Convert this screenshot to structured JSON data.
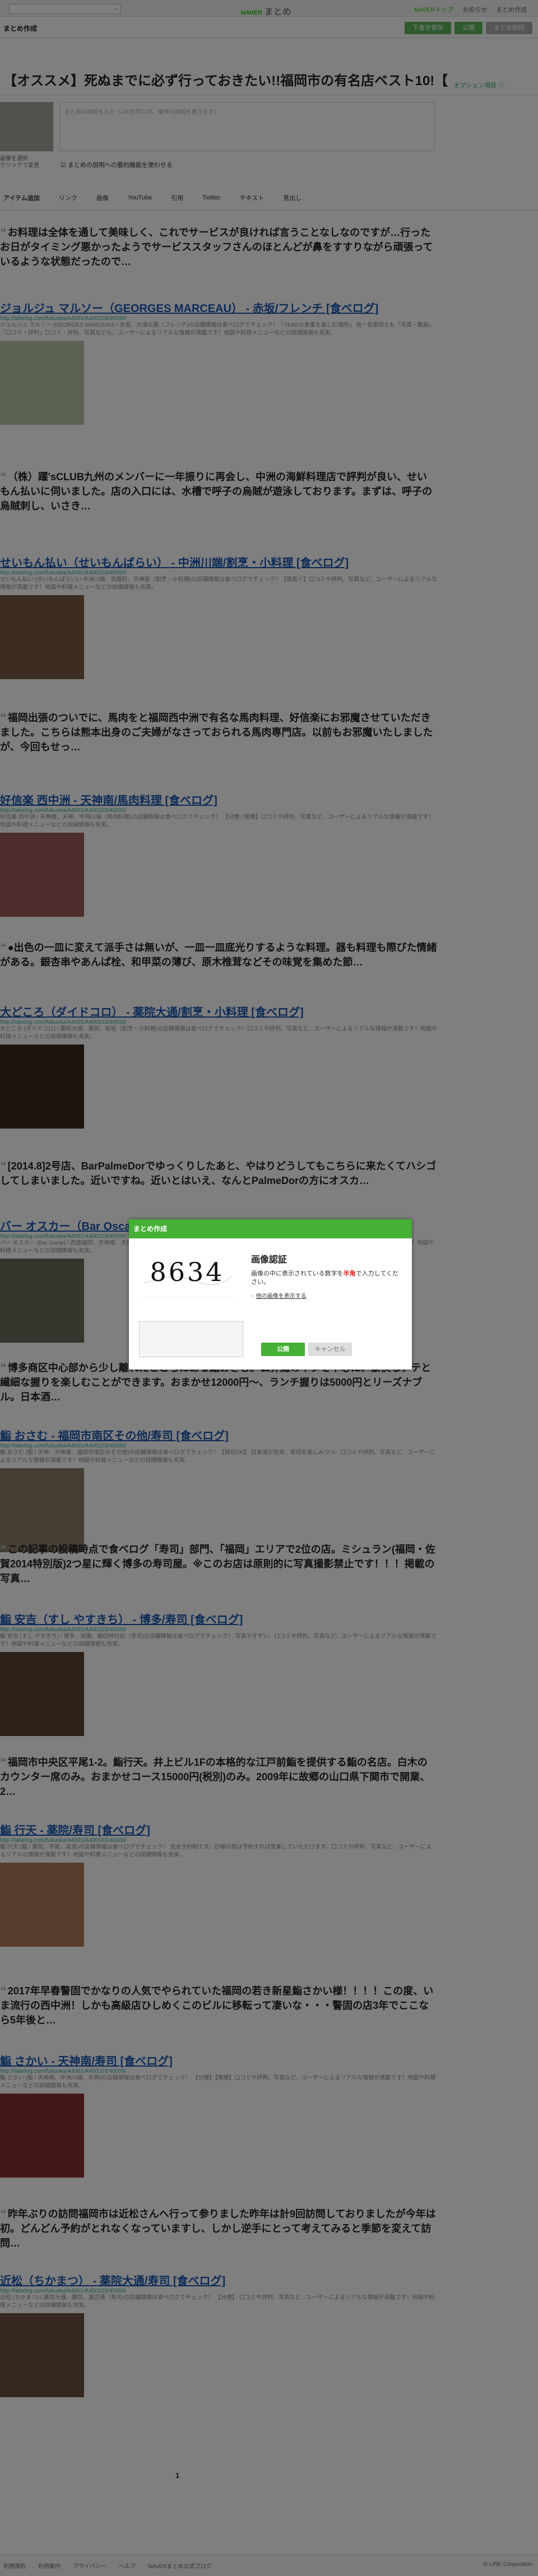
{
  "topbar": {
    "brand_naver": "NAVER",
    "brand_name": "まとめ",
    "links": [
      "NAVERトップ",
      "お知らせ",
      "まとめ作成"
    ]
  },
  "subbar": {
    "title": "まとめ作成",
    "buttons": [
      "下書き保存",
      "公開",
      "まとめ削除"
    ]
  },
  "matome": {
    "title": "【オススメ】死ぬまでに必ず行っておきたい!!福岡市の有名店ベスト10!【",
    "option": "オプション項目 ⓘ",
    "thumb_caption": "画像を選択\nクリックで変更",
    "desc_placeholder": "まとめの説明を入力（100文字以内。案件の説明を書きます）",
    "checkbox_label": "まとめの説明への要約機能を使わせる"
  },
  "tabs": [
    "アイテム追加",
    "リンク",
    "画像",
    "YouTube",
    "引用",
    "Twitter",
    "テキスト",
    "見出し"
  ],
  "items": [
    {
      "kind": "quote",
      "text": "お料理は全体を通して美味しく、これでサービスが良ければ言うことなしなのですが…行ったお日がタイミング悪かったようでサービススタッフさんのほとんどが鼻をすすりながら頑張っているような状態だったので…"
    },
    {
      "kind": "link",
      "title": "ジョルジュ マルソー（GEORGES MARCEAU） - 赤坂/フレンチ [食べログ]",
      "url": "http://tabelog.com/fukuoka/A4001/A400103/40000/",
      "snippet": "ジョルジュ マルソー (GEORGES MARCEAU) / 赤坂、大濠公園（フレンチ)の店舗情報は食べログでチェック！『TEAEの食事を楽しむ場所』 他 * 名家同士も『写真・動画』「口コミ・評判」口コミ・評判、写真なども。ユーザーによるリアルな情報が満載です！地図や料理メニューなどの詳細情報も充実。"
    },
    {
      "kind": "quote",
      "text": "（株）躍'sCLUB九州のメンバーに一年振りに再会し、中洲の海鮮料理店で評判が良い、せいもん払いに伺いました。店の入口には、水槽で呼子の烏賊が遊泳しております。まずは、呼子の烏賊刺し、いさき…"
    },
    {
      "kind": "link",
      "title": "せいもん払い（せいもんばらい） - 中洲川端/割烹・小料理 [食べログ]",
      "url": "http://tabelog.com/fukuoka/A4001/A400103/40000/",
      "snippet": "せいもん払い (せいもんばらい) / 中洲川端、呉服町、天神南（割烹・小料理)の店舗情報は食べログでチェック！【席直ぐ】口コミや評判、写真など、ユーザーによるリアルな情報が満載です！地図や料理メニューなどの詳細情報も充実。"
    },
    {
      "kind": "quote",
      "text": "福岡出張のついでに、馬肉をと福岡西中洲で有名な馬肉料理、好信楽にお邪魔させていただきました。こちらは熊本出身のご夫婦がなさっておられる馬肉専門店。以前もお邪魔いたしましたが、今回もせっ…"
    },
    {
      "kind": "link",
      "title": "好信楽 西中洲 - 天神南/馬肉料理 [食べログ]",
      "url": "http://tabelog.com/fukuoka/A4001/A400103/40000/",
      "snippet": "好信楽 西中洲 / 天神南、天神、中洲川端（馬肉料理)の店舗情報は食べログでチェック！ 【分煙 / 喫煙】口コミや評判、写真など、ユーザーによるリアルな情報が満載です！地図や料理メニューなどの詳細情報も充実。"
    },
    {
      "kind": "quote",
      "text": "●出色の一皿に変えて派手さは無いが、一皿一皿底光りするような料理。器も料理も際びた情緒がある。銀杏串やあんぱ栓、和甲菜の薄び、原木椎茸などその味覚を集めた節…"
    },
    {
      "kind": "link",
      "title": "大どころ（ダイドコロ） - 薬院大通/割烹・小料理 [食べログ]",
      "url": "http://tabelog.com/fukuoka/A4001/A400103/40000/",
      "snippet": "大どころ (ダイドコロ) / 薬院大通、薬院、桜坂（割烹・小料理)の店舗情報は食べログでチェック！口コミや評判、写真など、ユーザーによるリアルな情報が満載です！地図や料理メニューなどの詳細情報も充実。"
    },
    {
      "kind": "quote",
      "text": "[2014.8]2号店、BarPalmeDorでゆっくりしたあと、やはりどうしてもこちらに来たくてハシゴしてしまいました。近いですね。近いとはいえ、なんとPalmeDorの方にオスカ…"
    },
    {
      "kind": "link",
      "title": "バー オスカー（Bar Oscar） - 西鉄福岡/バー [食べログ]",
      "url": "http://tabelog.com/fukuoka/A4001/A400103/40000/",
      "snippet": "バー オスカー (Bar Oscar) / 西鉄福岡、天神南、天神（バー）の店舗情報は食べログでチェック！口コミや評判、写真など、ユーザーによるリアルな情報が満載です！地図や料理メニューなどの詳細情報も充実。"
    },
    {
      "kind": "quote",
      "text": "博多商区中心部から少し離れたところにある鮨おさむ。玄界灘のネタを中心に、豪快なアテと繊細な握りを楽しむことができます。おまかせ12000円〜、ランチ握りは5000円とリーズナブル。日本酒…"
    },
    {
      "kind": "link",
      "title": "鮨 おさむ - 福岡市南区その他/寿司 [食べログ]",
      "url": "http://tabelog.com/fukuoka/A4001/A400103/40000/",
      "snippet": "鮨 おさむ (鮨 / 天神、天神南、福岡市南区のその他)の店舗情報は食べログでチェック！【貸切OK】 日本酒が充実、寿司を楽しみつつ、口コミや評判、写真など、ユーザーによるリアルな情報が満載です！地図や料理メニューなどの詳細情報も充実。"
    },
    {
      "kind": "quote",
      "text": "この記事の投稿時点で食べログ「寿司」部門、「福岡」エリアで2位の店。ミシュラン(福岡・佐賀2014特別版)2つ星に輝く博多の寿司屋。※このお店は原則的に写真撮影禁止です！！！掲載の写真…"
    },
    {
      "kind": "link",
      "title": "鮨 安吉（すし やすきち） - 博多/寿司 [食べログ]",
      "url": "http://tabelog.com/fukuoka/A4001/A400103/40000/",
      "snippet": "鮨 安吉 (すし やすきち) / 博多、祇園、櫛田神社前（寿司)の店舗情報は食べログでチェック！ 写真やすずい、口コミや評判、写真など、ユーザーによるリアルな情報が満載です！地図や料理メニューなどの詳細情報も充実。"
    },
    {
      "kind": "quote",
      "text": "福岡市中央区平尾1-2。鮨行天。井上ビル1Fの本格的な江戸前鮨を提供する鮨の名店。白木のカウンター席のみ。おまかせコース15000円(税別)のみ。2009年に故郷の山口県下関市で開業、2…"
    },
    {
      "kind": "link",
      "title": "鮨 行天 - 薬院/寿司 [食べログ]",
      "url": "http://tabelog.com/fukuoka/A4001/A400103/40000/",
      "snippet": "鮨 行天 (鮨 / 薬院、平尾、高宮)の店舗情報は食べログでチェック！ 完全予約制です。日曜の夜は予約すれば営業していただけます。口コミや評判、写真など、ユーザーによるリアルな情報が満載です！地図や料理メニューなどの詳細情報も充実。"
    },
    {
      "kind": "quote",
      "text": "2017年早春警固でかなりの人気でやられていた福岡の若き新星鮨さかい様！！！！この度、いま流行の西中洲！しかも高級店ひしめくこのビルに移転って凄いな・・・警固の店3年でここなら5年後と…"
    },
    {
      "kind": "link",
      "title": "鮨 さかい - 天神南/寿司 [食べログ]",
      "url": "http://tabelog.com/fukuoka/A4001/A400103/40000/",
      "snippet": "鮨 さかい (鮨 / 天神南、中洲川端、天神)の店舗情報は食べログでチェック！ 【分煙】【喫煙】口コミや評判、写真など、ユーザーによるリアルな情報が満載です！地図や料理メニューなどの詳細情報も充実。"
    },
    {
      "kind": "quote",
      "text": "昨年ぶりの訪問福岡市は近松さんへ行って参りました昨年は計9回訪問しておりましたが今年は初。どんどん予約がとれなくなっていますし、しかし逆手にとって考えてみると季節を変えて訪問…"
    },
    {
      "kind": "link",
      "title": "近松（ちかまつ） - 薬院大通/寿司 [食べログ]",
      "url": "http://tabelog.com/fukuoka/A4001/A400103/40000/",
      "snippet": "近松 (ちかまつ) / 薬院大通、薬院、渡辺通（寿司)の店舗情報は食べログでチェック！ 【分煙】 口コミや評判、写真など、ユーザーによるリアルな情報が満載です！地図や料理メニューなどの詳細情報も充実。"
    }
  ],
  "pager": "1",
  "footer": {
    "links": [
      "利用規約",
      "利用案内",
      "プライバシー",
      "ヘルプ",
      "NAVERまとめ公式ブログ"
    ],
    "copyright": "© LINE Corporation"
  },
  "modal": {
    "header": "まとめ作成",
    "captcha_text": "8634",
    "heading": "画像認証",
    "instruction_a": "画像の中に表示されている数字を",
    "instruction_red": "半角",
    "instruction_b": "で入力してください。",
    "other_image": "他の画像を表示する",
    "ok": "公開",
    "cancel": "キャンセル"
  }
}
